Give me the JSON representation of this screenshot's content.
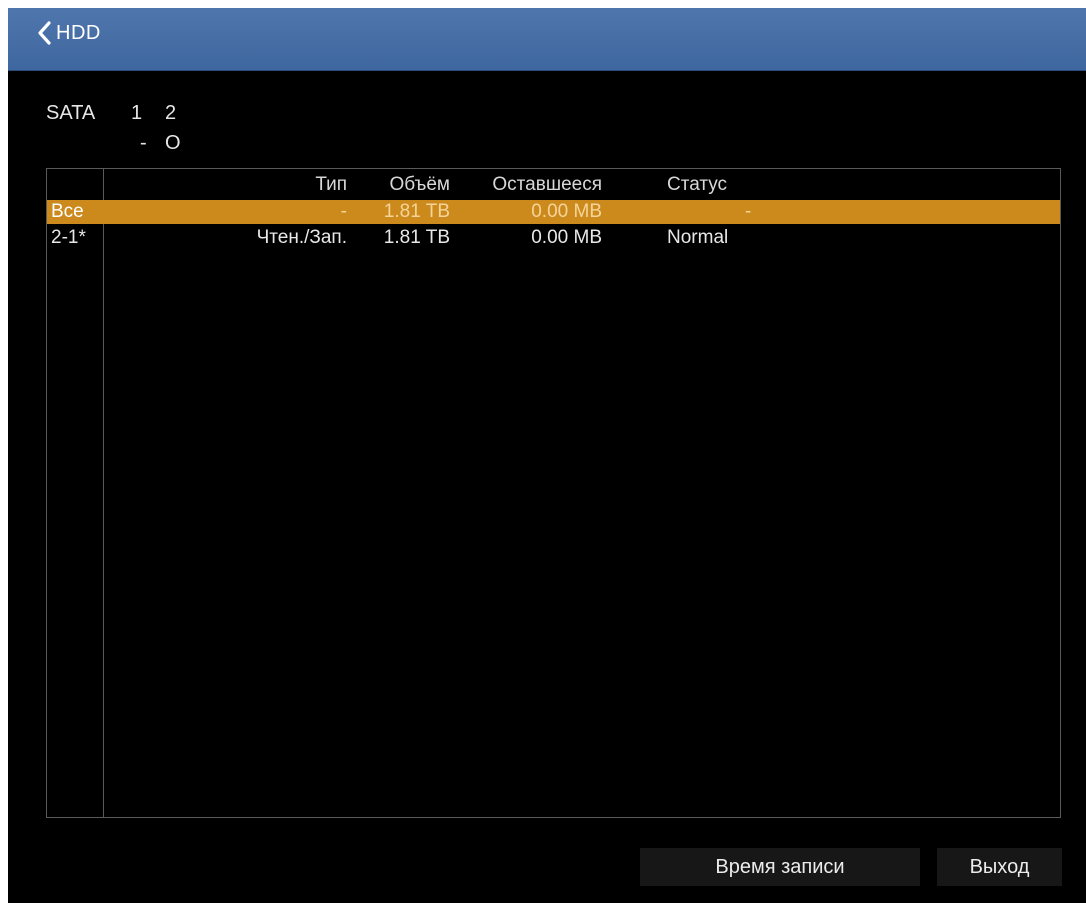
{
  "header": {
    "title": "HDD",
    "back_icon": "chevron-left-icon",
    "background_color": "#4a71a8"
  },
  "sata": {
    "label": "SATA",
    "ports": [
      {
        "number": "1",
        "state": "-"
      },
      {
        "number": "2",
        "state": "O"
      }
    ]
  },
  "table": {
    "columns": {
      "id": "",
      "type": "Тип",
      "size": "Объём",
      "free": "Оставшееся",
      "status": "Статус"
    },
    "rows": [
      {
        "id": "Все",
        "type": "-",
        "size": "1.81 TB",
        "free": "0.00 MB",
        "status": "-",
        "selected": true
      },
      {
        "id": "2-1*",
        "type": "Чтен./Зап.",
        "size": "1.81 TB",
        "free": "0.00 MB",
        "status": "Normal",
        "selected": false
      }
    ],
    "selection_color": "#cd8a1c"
  },
  "buttons": {
    "record_time": "Время записи",
    "exit": "Выход"
  }
}
